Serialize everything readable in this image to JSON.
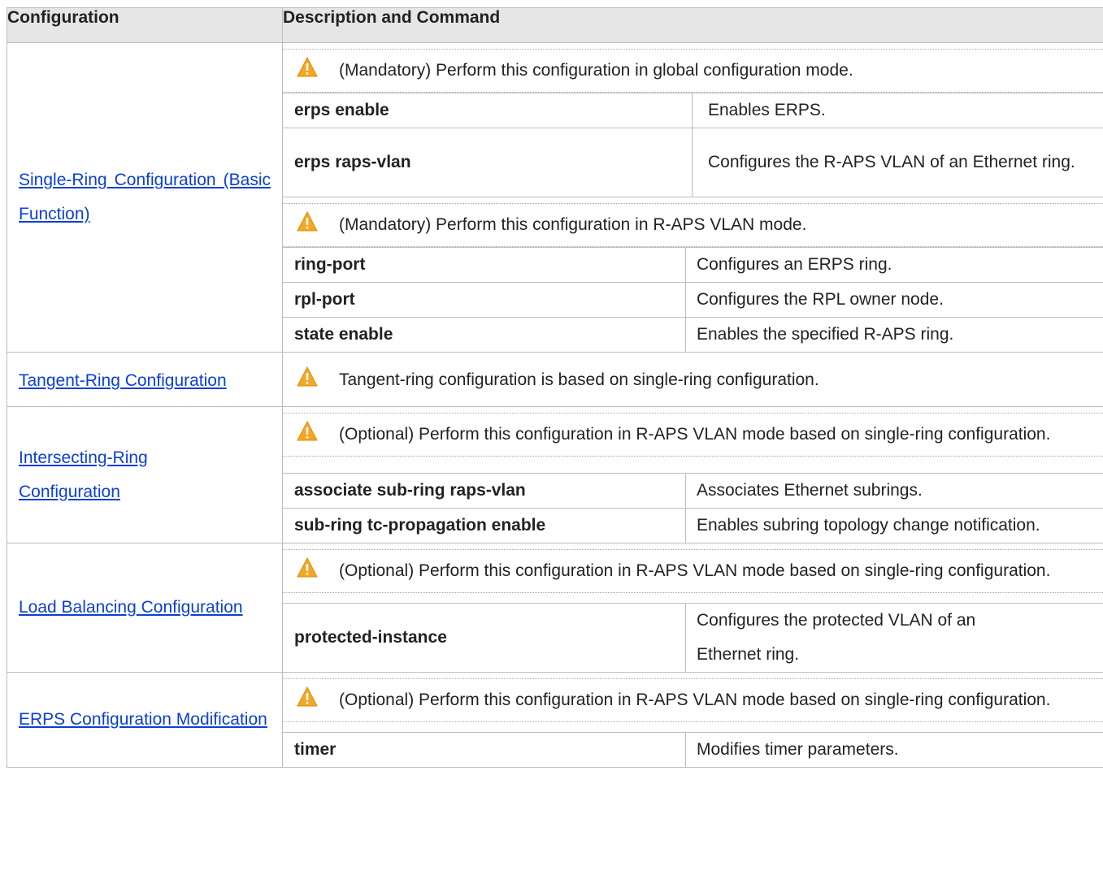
{
  "header": {
    "col1": "Configuration",
    "col2": "Description and Command"
  },
  "sections": [
    {
      "link_lines": [
        "Single-Ring Configuration",
        "(Basic Function)"
      ],
      "groups": [
        {
          "note": "(Mandatory) Perform this configuration in global configuration mode.",
          "rows": [
            {
              "cmd": "erps enable",
              "desc": "Enables ERPS."
            },
            {
              "cmd": "erps raps-vlan",
              "desc": "Configures the R-APS VLAN of an Ethernet ring."
            }
          ]
        },
        {
          "note": "(Mandatory) Perform this configuration in R-APS VLAN mode.",
          "rows": [
            {
              "cmd": "ring-port",
              "desc": "Configures an ERPS ring."
            },
            {
              "cmd": "rpl-port",
              "desc": "Configures the RPL owner node."
            },
            {
              "cmd": "state enable",
              "desc": "Enables the specified R-APS ring."
            }
          ]
        }
      ]
    },
    {
      "link_lines": [
        "Tangent-Ring Configuration"
      ],
      "groups": [
        {
          "note": "Tangent-ring configuration is based on single-ring configuration.",
          "rows": []
        }
      ]
    },
    {
      "link_lines": [
        "Intersecting-Ring",
        "Configuration"
      ],
      "groups": [
        {
          "note": "(Optional) Perform this configuration in R-APS VLAN mode based on single-ring configuration.",
          "rows": [
            {
              "cmd": "associate sub-ring raps-vlan",
              "desc": "Associates Ethernet subrings."
            },
            {
              "cmd": "sub-ring tc-propagation enable",
              "desc": "Enables subring topology change notification."
            }
          ]
        }
      ]
    },
    {
      "link_lines": [
        "Load Balancing",
        "Configuration"
      ],
      "groups": [
        {
          "note": "(Optional) Perform this configuration in R-APS VLAN mode based on single-ring configuration.",
          "rows": [
            {
              "cmd": "protected-instance",
              "desc": "Configures the protected VLAN of an Ethernet ring."
            }
          ]
        }
      ]
    },
    {
      "link_lines": [
        "ERPS Configuration",
        "Modification"
      ],
      "groups": [
        {
          "note": "(Optional) Perform this configuration in R-APS VLAN mode based on single-ring configuration.",
          "rows": [
            {
              "cmd": "timer",
              "desc": "Modifies timer parameters."
            }
          ]
        }
      ]
    }
  ],
  "icons": {
    "warning": "warning-triangle-icon",
    "warning_color": "#f5a623"
  },
  "colors": {
    "link": "#0b3fd6",
    "header_bg": "#e6e6e6",
    "border": "#bdbdbd"
  }
}
